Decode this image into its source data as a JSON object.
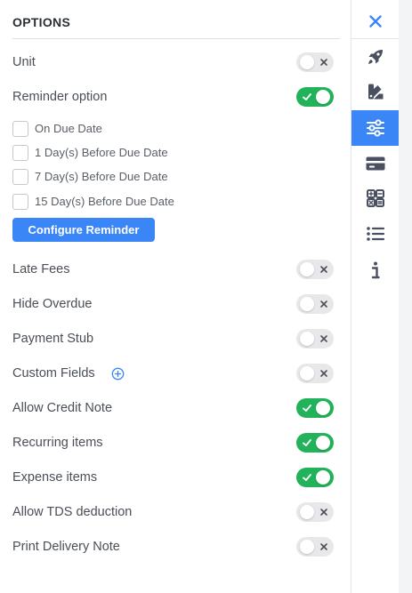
{
  "panel": {
    "title": "OPTIONS",
    "options_top": [
      {
        "label": "Unit",
        "enabled": false
      },
      {
        "label": "Reminder option",
        "enabled": true
      }
    ],
    "reminders": [
      {
        "label": "On Due Date",
        "checked": false
      },
      {
        "label": "1 Day(s) Before Due Date",
        "checked": false
      },
      {
        "label": "7 Day(s) Before Due Date",
        "checked": false
      },
      {
        "label": "15 Day(s) Before Due Date",
        "checked": false
      }
    ],
    "configure_button": "Configure Reminder",
    "options": [
      {
        "label": "Late Fees",
        "enabled": false
      },
      {
        "label": "Hide Overdue",
        "enabled": false
      },
      {
        "label": "Payment Stub",
        "enabled": false
      },
      {
        "label": "Custom Fields",
        "enabled": false
      },
      {
        "label": "Allow Credit Note",
        "enabled": true
      },
      {
        "label": "Recurring items",
        "enabled": true
      },
      {
        "label": "Expense items",
        "enabled": true
      },
      {
        "label": "Allow TDS deduction",
        "enabled": false
      },
      {
        "label": "Print Delivery Note",
        "enabled": false
      }
    ]
  },
  "sidebar": {
    "items": [
      {
        "icon": "close-icon",
        "active": false
      },
      {
        "icon": "rocket-icon",
        "active": false
      },
      {
        "icon": "swatch-book-icon",
        "active": false
      },
      {
        "icon": "sliders-icon",
        "active": true
      },
      {
        "icon": "credit-card-icon",
        "active": false
      },
      {
        "icon": "calculator-icon",
        "active": false
      },
      {
        "icon": "list-icon",
        "active": false
      },
      {
        "icon": "info-icon",
        "active": false
      }
    ]
  },
  "colors": {
    "accent": "#3b86f7",
    "toggle_on": "#22b35a",
    "toggle_off": "#e8e8ea",
    "icon_dark": "#4a5060"
  }
}
